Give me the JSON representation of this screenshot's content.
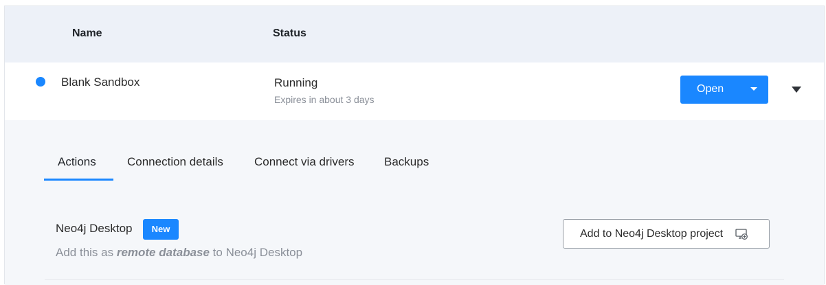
{
  "table": {
    "headers": {
      "name": "Name",
      "status": "Status"
    },
    "row": {
      "name": "Blank Sandbox",
      "status": "Running",
      "expiry": "Expires in about 3 days",
      "status_color": "#1a87ff",
      "open_label": "Open"
    }
  },
  "tabs": [
    {
      "label": "Actions",
      "active": true
    },
    {
      "label": "Connection details",
      "active": false
    },
    {
      "label": "Connect via drivers",
      "active": false
    },
    {
      "label": "Backups",
      "active": false
    }
  ],
  "actions": {
    "desktop": {
      "title": "Neo4j Desktop",
      "badge": "New",
      "desc_prefix": "Add this as ",
      "desc_emphasis": "remote database",
      "desc_suffix": " to Neo4j Desktop",
      "button_label": "Add to Neo4j Desktop project",
      "button_icon": "desktop-add-icon"
    }
  },
  "colors": {
    "accent": "#1a87ff",
    "header_bg": "#edf1f8",
    "panel_bg": "#f5f7fa"
  }
}
